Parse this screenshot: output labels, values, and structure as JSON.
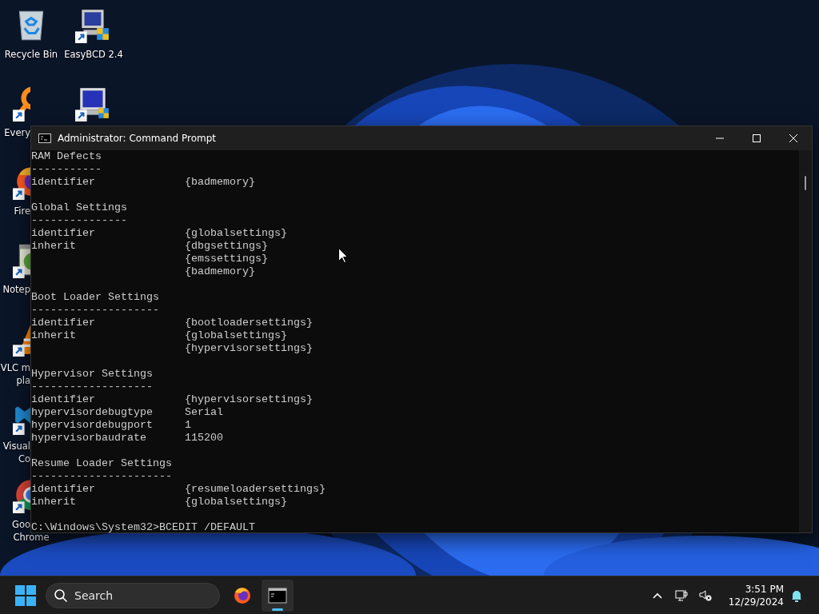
{
  "desktop_icons": [
    {
      "kind": "recycle-bin",
      "label": [
        {
          "text": "Recycle Bin",
          "cut": false
        }
      ],
      "shortcut": false
    },
    {
      "kind": "everything",
      "label": [
        {
          "text": "Every",
          "cut": true
        }
      ],
      "shortcut": true
    },
    {
      "kind": "firefox",
      "label": [
        {
          "text": "Fire",
          "cut": true
        }
      ],
      "shortcut": true
    },
    {
      "kind": "notepad",
      "label": [
        {
          "text": "Notep",
          "cut": true
        }
      ],
      "shortcut": true
    },
    {
      "kind": "vlc",
      "label": [
        {
          "text": "VLC m",
          "cut": true
        },
        {
          "text": "pla",
          "cut": true
        }
      ],
      "shortcut": true
    },
    {
      "kind": "vscode",
      "label": [
        {
          "text": "Visual",
          "cut": true
        },
        {
          "text": "Co",
          "cut": true
        }
      ],
      "shortcut": true
    },
    {
      "kind": "chrome",
      "label": [
        {
          "text": "Goo",
          "cut": true
        },
        {
          "text": "Chrome",
          "cut": false
        }
      ],
      "shortcut": true
    },
    {
      "kind": "easybcd",
      "label": [
        {
          "text": "EasyBCD 2.4",
          "cut": false
        }
      ],
      "shortcut": true
    },
    {
      "kind": "easyuefi",
      "shortcut": true
    }
  ],
  "window": {
    "title": "Administrator: Command Prompt",
    "sections": [
      {
        "heading": "RAM Defects",
        "rule": "-----------",
        "entries": [
          {
            "key": "identifier",
            "value": "{badmemory}"
          }
        ]
      },
      {
        "heading": "Global Settings",
        "rule": "---------------",
        "entries": [
          {
            "key": "identifier",
            "value": "{globalsettings}"
          },
          {
            "key": "inherit",
            "value": "{dbgsettings}"
          },
          {
            "value": "{emssettings}"
          },
          {
            "value": "{badmemory}"
          }
        ]
      },
      {
        "heading": "Boot Loader Settings",
        "rule": "--------------------",
        "entries": [
          {
            "key": "identifier",
            "value": "{bootloadersettings}"
          },
          {
            "key": "inherit",
            "value": "{globalsettings}"
          },
          {
            "value": "{hypervisorsettings}"
          }
        ]
      },
      {
        "heading": "Hypervisor Settings",
        "rule": "-------------------",
        "entries": [
          {
            "key": "identifier",
            "value": "{hypervisorsettings}"
          },
          {
            "key": "hypervisordebugtype",
            "value": "Serial"
          },
          {
            "key": "hypervisordebugport",
            "value": "1"
          },
          {
            "key": "hypervisorbaudrate",
            "value": "115200"
          }
        ]
      },
      {
        "heading": "Resume Loader Settings",
        "rule": "----------------------",
        "entries": [
          {
            "key": "identifier",
            "value": "{resumeloadersettings}"
          },
          {
            "key": "inherit",
            "value": "{globalsettings}"
          }
        ]
      }
    ],
    "prompt": "C:\\Windows\\System32>BCEDIT /DEFAULT"
  },
  "taskbar": {
    "search": {
      "placeholder": "Search"
    },
    "apps": [
      {
        "kind": "firefox",
        "selected": false
      },
      {
        "kind": "terminal",
        "selected": true
      }
    ],
    "clock": {
      "time": "3:51 PM",
      "date": "12/29/2024"
    }
  }
}
